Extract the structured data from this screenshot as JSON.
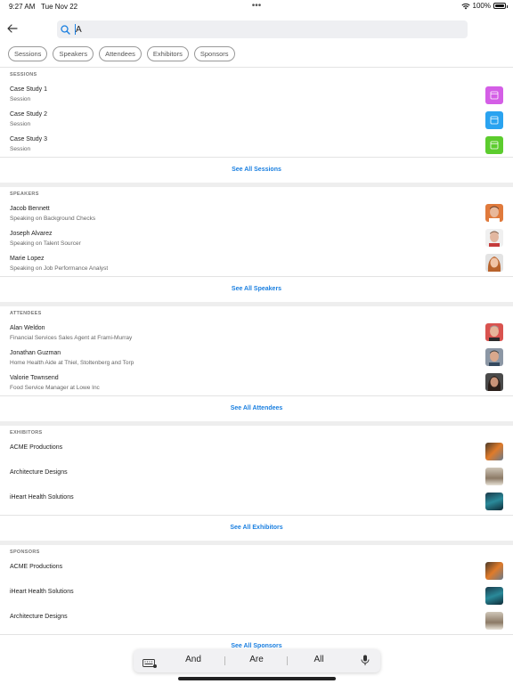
{
  "status": {
    "time": "9:27 AM",
    "date": "Tue Nov 22",
    "dots": "•••",
    "battery": "100%"
  },
  "search": {
    "value": "A",
    "placeholder": ""
  },
  "chips": [
    "Sessions",
    "Speakers",
    "Attendees",
    "Exhibitors",
    "Sponsors"
  ],
  "sessions": {
    "title": "SESSIONS",
    "items": [
      {
        "title": "Case Study 1",
        "sub": "Session",
        "color": "#d45ee6"
      },
      {
        "title": "Case Study 2",
        "sub": "Session",
        "color": "#2aa3f0"
      },
      {
        "title": "Case Study 3",
        "sub": "Session",
        "color": "#5ccc2e"
      }
    ],
    "see_all": "See All Sessions"
  },
  "speakers": {
    "title": "SPEAKERS",
    "items": [
      {
        "title": "Jacob Bennett",
        "sub": "Speaking on Background Checks"
      },
      {
        "title": "Joseph Alvarez",
        "sub": "Speaking on Talent Sourcer"
      },
      {
        "title": "Marie Lopez",
        "sub": "Speaking on Job Performance Analyst"
      }
    ],
    "see_all": "See All Speakers"
  },
  "attendees": {
    "title": "ATTENDEES",
    "items": [
      {
        "title": "Alan Weldon",
        "sub": "Financial Services Sales Agent at Frami-Murray"
      },
      {
        "title": "Jonathan Guzman",
        "sub": "Home Health Aide at Thiel, Stoltenberg and Torp"
      },
      {
        "title": "Valorie Townsend",
        "sub": "Food Service Manager at Lowe Inc"
      }
    ],
    "see_all": "See All Attendees"
  },
  "exhibitors": {
    "title": "EXHIBITORS",
    "items": [
      {
        "title": "ACME Productions"
      },
      {
        "title": "Architecture Designs"
      },
      {
        "title": "iHeart Health Solutions"
      }
    ],
    "see_all": "See All Exhibitors"
  },
  "sponsors": {
    "title": "SPONSORS",
    "items": [
      {
        "title": "ACME Productions"
      },
      {
        "title": "iHeart Health Solutions"
      },
      {
        "title": "Architecture Designs"
      }
    ],
    "see_all": "See All Sponsors"
  },
  "keyboard": {
    "predictions": [
      "And",
      "Are",
      "All"
    ]
  }
}
